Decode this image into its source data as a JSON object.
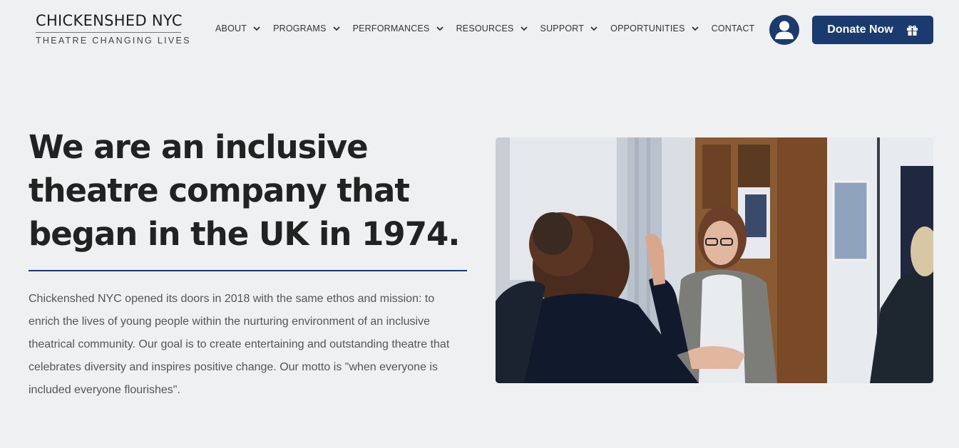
{
  "header": {
    "logo_main": "CHICKENSHED NYC",
    "logo_sub": "THEATRE CHANGING LIVES",
    "nav": [
      {
        "label": "ABOUT",
        "has_dropdown": true
      },
      {
        "label": "PROGRAMS",
        "has_dropdown": true
      },
      {
        "label": "PERFORMANCES",
        "has_dropdown": true
      },
      {
        "label": "RESOURCES",
        "has_dropdown": true
      },
      {
        "label": "SUPPORT",
        "has_dropdown": true
      },
      {
        "label": "OPPORTUNITIES",
        "has_dropdown": true
      },
      {
        "label": "CONTACT",
        "has_dropdown": false
      }
    ],
    "account_icon": "user-icon",
    "donate_label": "Donate Now",
    "donate_icon": "gift-icon"
  },
  "hero": {
    "headline": "We are an inclusive theatre company that began in the UK in 1974.",
    "body": "Chickenshed NYC opened its doors in 2018 with the same ethos and mission: to enrich the lives of young people within the nurturing environment of an inclusive theatrical community. Our goal is to create entertaining and outstanding theatre that celebrates diversity and inspires positive change. Our motto is \"when everyone is included everyone flourishes\"."
  },
  "colors": {
    "background": "#eef0f1",
    "brand_navy": "#1b3a70",
    "text_dark": "#222222",
    "text_body": "#555555"
  }
}
